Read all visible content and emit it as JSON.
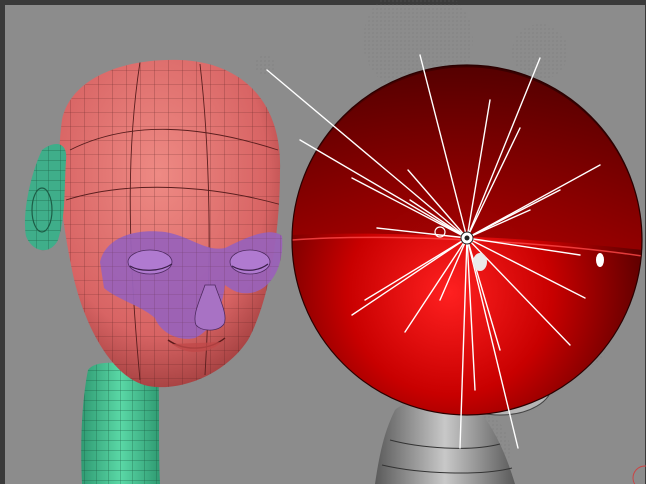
{
  "viewport": {
    "background_color": "#8c8c8c",
    "frame_color": "#3a3a3a",
    "wire_color": "#2a1a1a"
  },
  "head_model": {
    "skin_color": "#d86464",
    "eye_mask_color": "#9a62b8",
    "ear_color": "#3fae8a",
    "neck_color": "#3fc491"
  },
  "sphere_model": {
    "base_color": "#c80000",
    "highlight_color": "#ff4040",
    "shadow_color": "#4a0000"
  },
  "figurine_model": {
    "color": "#a5a5a5"
  },
  "light_rig": {
    "ray_color": "#ffffff",
    "ray_count": 24
  }
}
